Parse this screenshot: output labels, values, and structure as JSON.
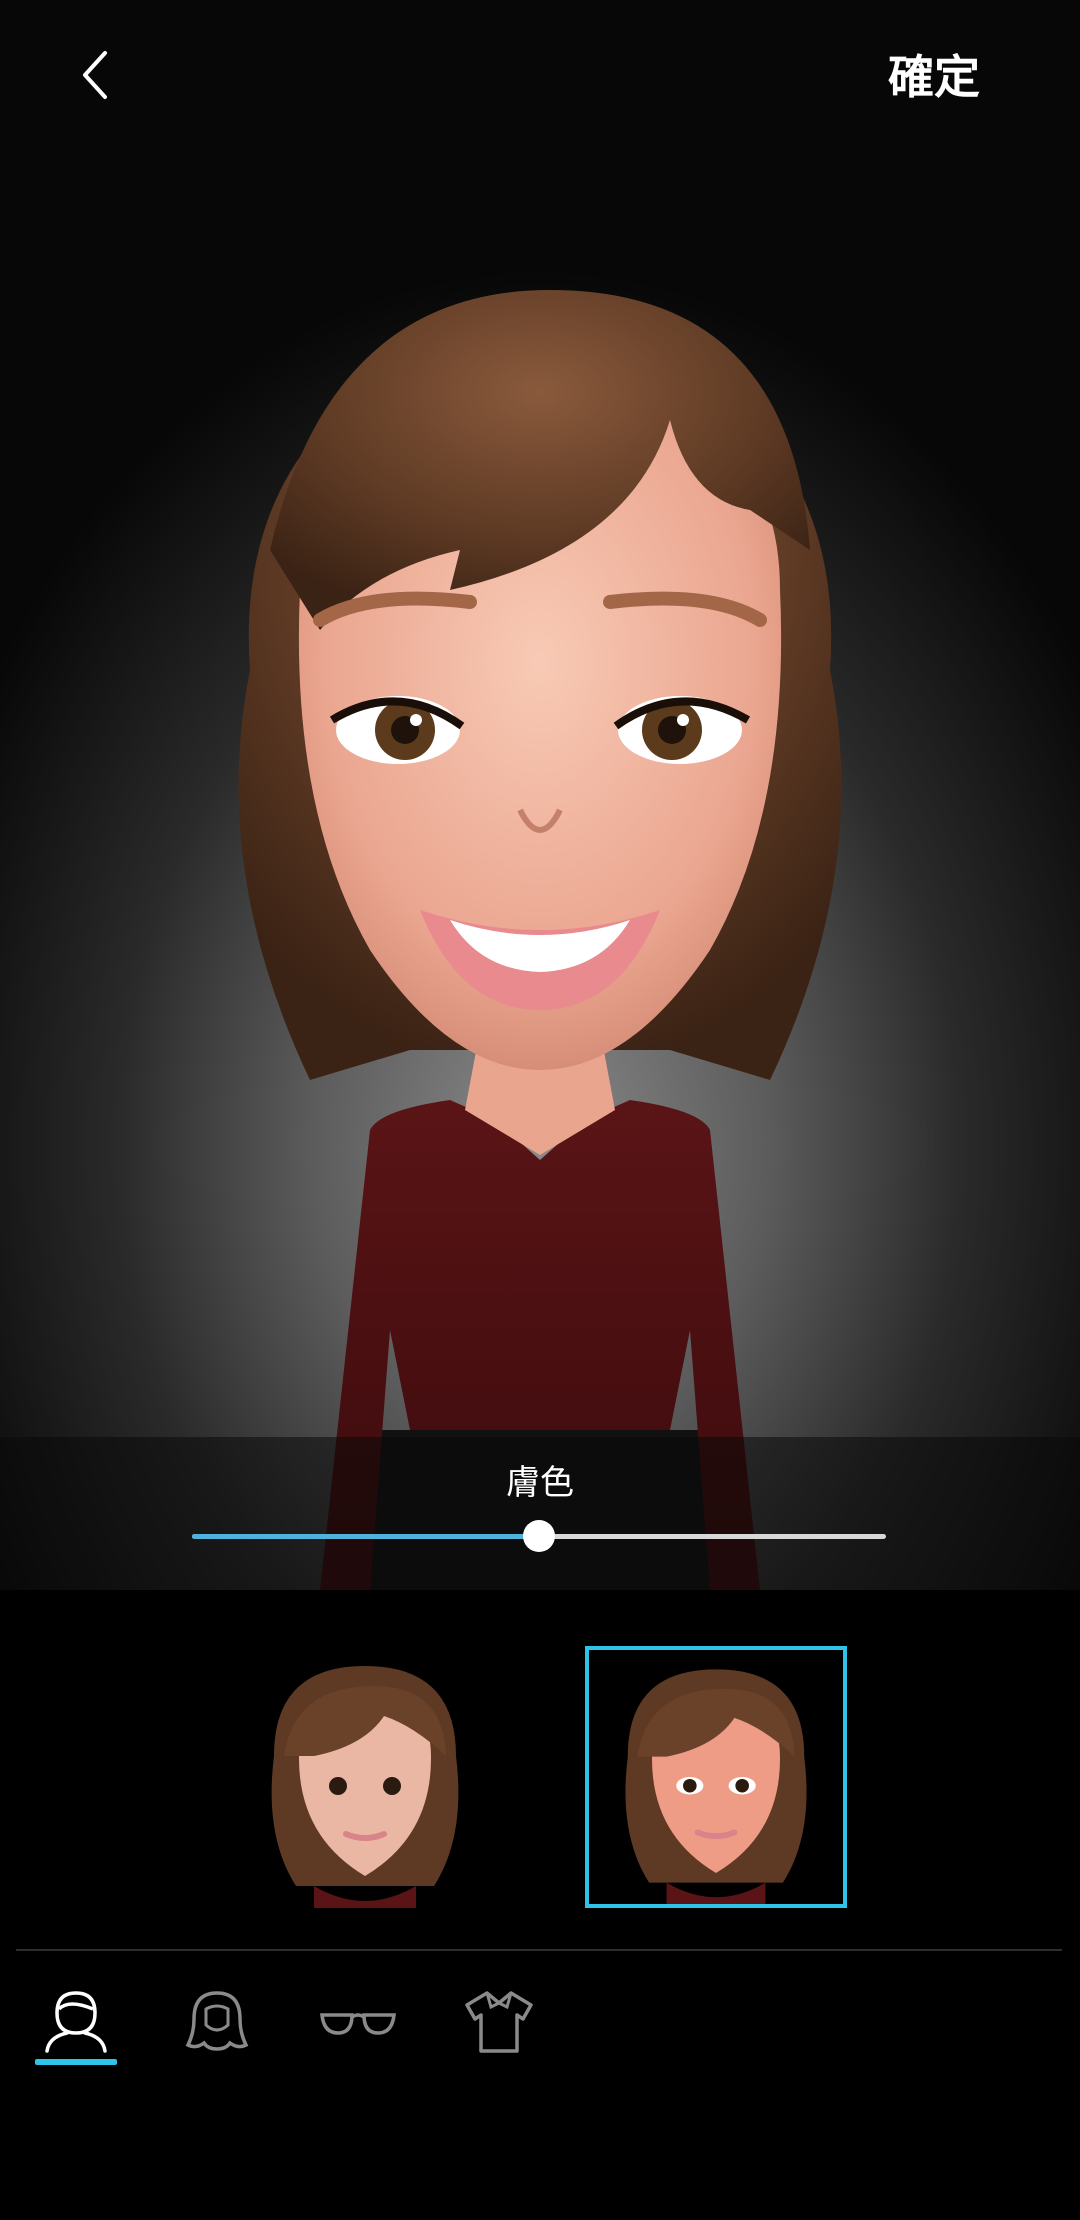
{
  "header": {
    "back_icon": "chevron-left-icon",
    "confirm_label": "確定"
  },
  "preview": {
    "avatar": "avatar-preview-large"
  },
  "slider": {
    "label": "膚色",
    "value_percent": 50,
    "accent_color": "#4fb2dc"
  },
  "variants": {
    "items": [
      {
        "name": "avatar-variant-1",
        "selected": false
      },
      {
        "name": "avatar-variant-2",
        "selected": true
      }
    ],
    "selected_color": "#2ec4e8"
  },
  "tabs": {
    "items": [
      {
        "icon": "face-icon",
        "active": true
      },
      {
        "icon": "hair-icon",
        "active": false
      },
      {
        "icon": "glasses-icon",
        "active": false
      },
      {
        "icon": "shirt-icon",
        "active": false
      }
    ]
  }
}
